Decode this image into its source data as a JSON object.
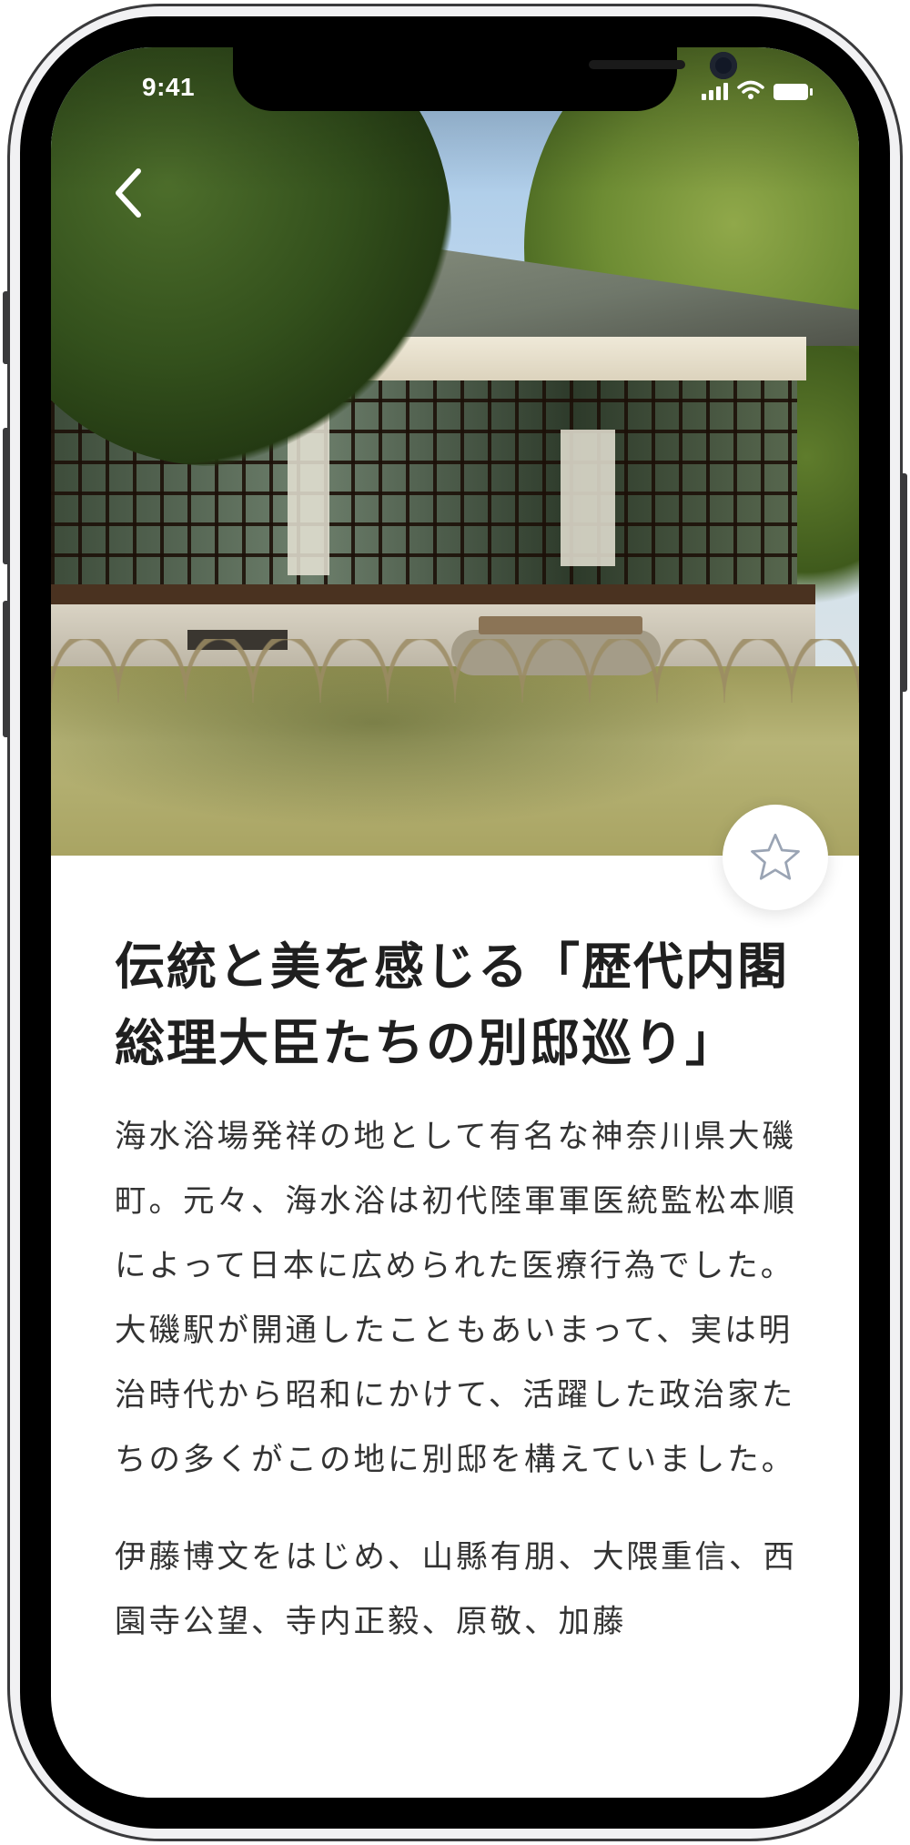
{
  "status_bar": {
    "time": "9:41"
  },
  "hero": {
    "image_alt": "Japanese historic villa with garden"
  },
  "article": {
    "title": "伝統と美を感じる「歴代内閣総理大臣たちの別邸巡り」",
    "paragraphs": [
      "海水浴場発祥の地として有名な神奈川県大磯町。元々、海水浴は初代陸軍軍医統監松本順によって日本に広められた医療行為でした。大磯駅が開通したこともあいまって、実は明治時代から昭和にかけて、活躍した政治家たちの多くがこの地に別邸を構えていました。",
      "伊藤博文をはじめ、山縣有朋、大隈重信、西園寺公望、寺内正毅、原敬、加藤"
    ]
  },
  "icons": {
    "back": "chevron-left-icon",
    "favorite": "star-outline-icon"
  },
  "colors": {
    "favorite_icon": "#9aa4b4",
    "title": "#1f1f1f",
    "body": "#333333"
  }
}
